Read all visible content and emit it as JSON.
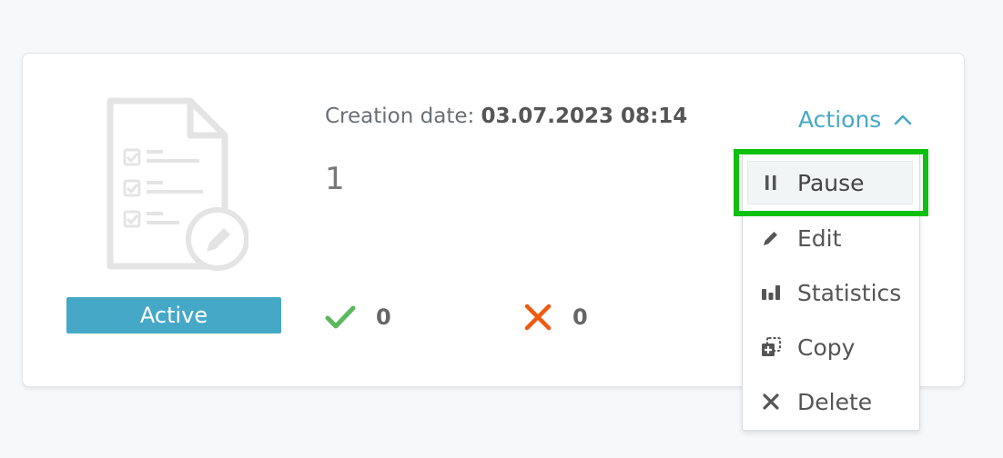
{
  "card": {
    "status_badge": "Active",
    "creation_label": "Creation date:",
    "creation_value": "03.07.2023 08:14",
    "title_number": "1",
    "success_count": "0",
    "fail_count": "0"
  },
  "actions": {
    "toggle_label": "Actions",
    "menu": [
      {
        "label": "Pause",
        "icon": "pause-icon"
      },
      {
        "label": "Edit",
        "icon": "pencil-icon"
      },
      {
        "label": "Statistics",
        "icon": "bar-chart-icon"
      },
      {
        "label": "Copy",
        "icon": "copy-icon"
      },
      {
        "label": "Delete",
        "icon": "x-icon"
      }
    ]
  },
  "colors": {
    "accent": "#46a8c7",
    "success": "#5cb85c",
    "danger": "#ef5a12",
    "highlight": "#0ec10e"
  }
}
